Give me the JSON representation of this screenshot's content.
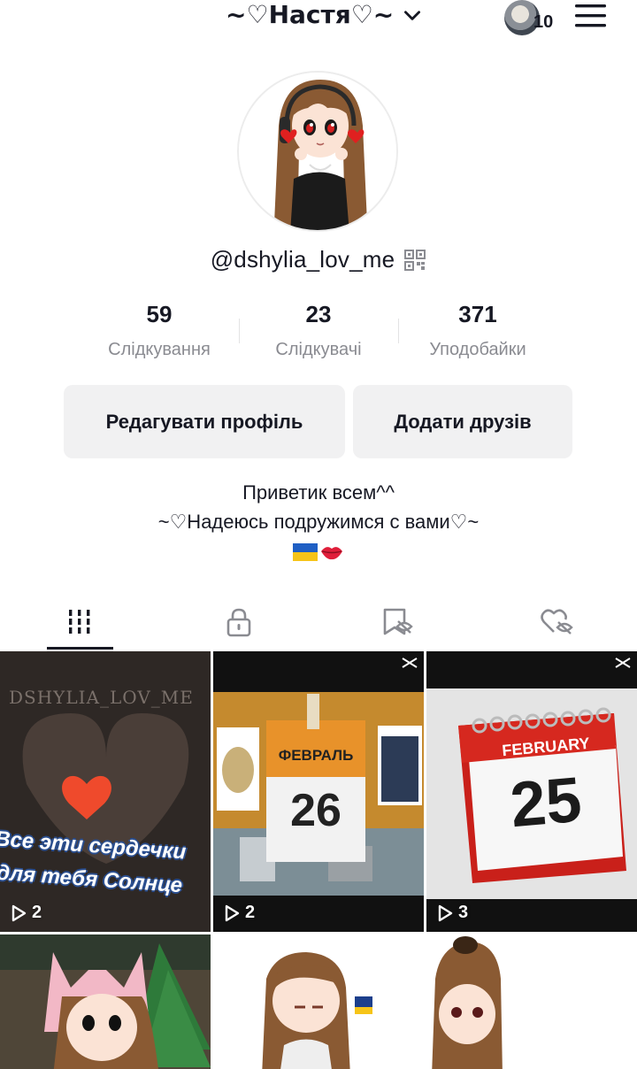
{
  "header": {
    "title": "~♡Настя♡~",
    "notification_count": "10"
  },
  "profile": {
    "username": "@dshylia_lov_me"
  },
  "stats": [
    {
      "value": "59",
      "label": "Слідкування"
    },
    {
      "value": "23",
      "label": "Слідкувачі"
    },
    {
      "value": "371",
      "label": "Уподобайки"
    }
  ],
  "buttons": {
    "edit_profile": "Редагувати профіль",
    "add_friends": "Додати друзів"
  },
  "bio": {
    "line1": "Приветик всем^^",
    "line2": "~♡Надеюсь подружимся с вами♡~"
  },
  "tabs": [
    {
      "icon": "grid-icon",
      "active": true
    },
    {
      "icon": "lock-icon",
      "active": false
    },
    {
      "icon": "bookmark-hidden-icon",
      "active": false
    },
    {
      "icon": "heart-hidden-icon",
      "active": false
    }
  ],
  "videos": [
    {
      "views": "2",
      "overlay_text_top": "DSHYLIA_LOV_ME",
      "overlay_text_1": "Все эти сердечки",
      "overlay_text_2": "для тебя Солнце"
    },
    {
      "views": "2",
      "calendar_month": "ФЕВРАЛЬ",
      "calendar_day": "26"
    },
    {
      "views": "3",
      "calendar_month": "FEBRUARY",
      "calendar_day": "25"
    },
    {
      "views": ""
    },
    {
      "views": ""
    },
    {
      "views": ""
    }
  ],
  "colors": {
    "text_primary": "#161823",
    "text_secondary": "#8a8b91",
    "button_bg": "#f1f1f2",
    "divider": "#e3e3e4"
  }
}
